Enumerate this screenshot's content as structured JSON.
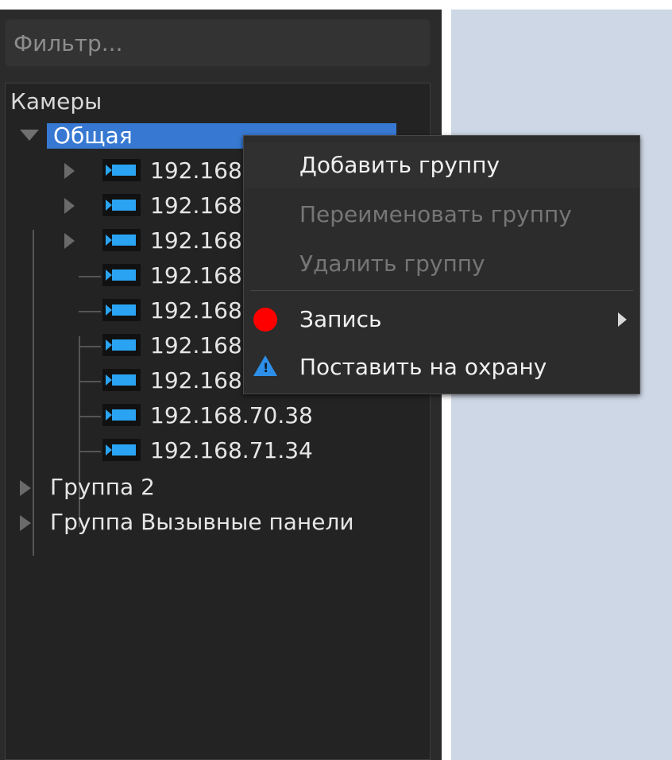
{
  "filter": {
    "placeholder": "Фильтр..."
  },
  "tree": {
    "header": "Камеры",
    "groups": [
      {
        "label": "Общая",
        "expanded": true,
        "selected": true
      },
      {
        "label": "Группа 2",
        "expanded": false
      },
      {
        "label": "Группа Вызывные панели",
        "expanded": false
      }
    ],
    "cameras": [
      {
        "label": "192.168",
        "has_children": true
      },
      {
        "label": "192.168",
        "has_children": true
      },
      {
        "label": "192.168",
        "has_children": true
      },
      {
        "label": "192.168",
        "has_children": false
      },
      {
        "label": "192.168",
        "has_children": false
      },
      {
        "label": "192.168",
        "has_children": false
      },
      {
        "label": "192.168",
        "has_children": false
      },
      {
        "label": "192.168.70.38",
        "has_children": false
      },
      {
        "label": "192.168.71.34",
        "has_children": false
      }
    ]
  },
  "context_menu": {
    "items": [
      {
        "label": "Добавить группу",
        "enabled": true
      },
      {
        "label": "Переименовать группу",
        "enabled": false
      },
      {
        "label": "Удалить группу",
        "enabled": false
      },
      {
        "label": "Запись",
        "enabled": true,
        "icon": "record-icon",
        "has_submenu": true
      },
      {
        "label": "Поставить на охрану",
        "enabled": true,
        "icon": "arm-warning-icon"
      }
    ]
  },
  "colors": {
    "panel_bg": "#2b2b2b",
    "tree_bg": "#232323",
    "selection": "#3779d2",
    "camera_icon": "#2aa3f2",
    "record_icon": "#ff0000",
    "arm_icon": "#2d8fe8",
    "right_area": "#cdd7e5"
  }
}
